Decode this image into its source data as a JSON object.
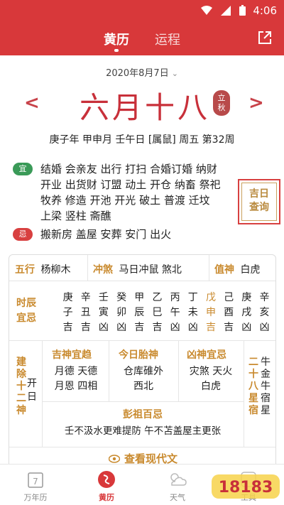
{
  "status_bar": {
    "time": "4:06",
    "icons": [
      "wifi-icon",
      "signal-icon",
      "battery-icon"
    ]
  },
  "top_tabs": {
    "active": "黄历",
    "other": "运程"
  },
  "date": {
    "selector": "2020年8月7日",
    "lunar": "六月十八",
    "jieqi": [
      "立",
      "秋"
    ],
    "ganzhi": "庚子年 甲申月 壬午日 [属鼠] 周五 第32周"
  },
  "yi": {
    "badge": "宜",
    "lines": [
      "结婚 会亲友 出行 打扫 合婚订婚 纳财",
      "开业 出货财 订盟 动土 开仓 纳畜 祭祀",
      "牧养 修造 开池 开光 破土 普渡 迁坟",
      "上梁 竖柱 斋醮"
    ]
  },
  "ji": {
    "badge": "忌",
    "text": "搬新房 盖屋 安葬 安门 出火"
  },
  "jiri_button": [
    "吉日",
    "查询"
  ],
  "table": {
    "wuxing": {
      "label": "五行",
      "value": "杨柳木"
    },
    "chongsha": {
      "label": "冲煞",
      "value": "马日冲鼠 煞北"
    },
    "zhishen": {
      "label": "值神",
      "value": "白虎"
    },
    "shichen_label": [
      "时",
      "辰",
      "宜",
      "忌"
    ],
    "hours": [
      [
        "庚",
        "子",
        "吉"
      ],
      [
        "辛",
        "丑",
        "吉"
      ],
      [
        "壬",
        "寅",
        "凶"
      ],
      [
        "癸",
        "卯",
        "凶"
      ],
      [
        "甲",
        "辰",
        "吉"
      ],
      [
        "乙",
        "巳",
        "吉"
      ],
      [
        "丙",
        "午",
        "凶"
      ],
      [
        "丁",
        "未",
        "凶"
      ],
      [
        "戊",
        "申",
        "吉"
      ],
      [
        "己",
        "酉",
        "吉"
      ],
      [
        "庚",
        "戌",
        "凶"
      ],
      [
        "辛",
        "亥",
        "凶"
      ]
    ],
    "jianchu_label": [
      "建",
      "除",
      "十",
      "二",
      "神"
    ],
    "jianchu_value": [
      "开",
      "日"
    ],
    "jishen": {
      "label": "吉神宜趋",
      "lines": [
        "月德 天德",
        "月恩 四相"
      ]
    },
    "taishen": {
      "label": "今日胎神",
      "lines": [
        "仓库碓外",
        "西北"
      ]
    },
    "xiongshen": {
      "label": "凶神宜忌",
      "lines": [
        "灾煞 天火",
        "白虎"
      ]
    },
    "xingxiu_label": [
      "二",
      "十",
      "八",
      "星",
      "宿"
    ],
    "xingxiu_value": [
      "牛",
      "金",
      "牛",
      "宿",
      "星"
    ],
    "pengzu": {
      "label": "彭祖百忌",
      "text": "壬不汲水更难提防 午不苫盖屋主更张"
    },
    "view_modern": "查看现代文"
  },
  "tabbar": [
    {
      "label": "万年历",
      "icon": "calendar-icon",
      "num": "7"
    },
    {
      "label": "黄历",
      "icon": "huangli-icon"
    },
    {
      "label": "天气",
      "icon": "weather-icon"
    },
    {
      "label": "工具",
      "icon": "tools-icon"
    }
  ],
  "watermark": "18183",
  "colors": {
    "brand_red": "#d8383a",
    "gold": "#c98a2e",
    "yi_green": "#3a9a58"
  }
}
